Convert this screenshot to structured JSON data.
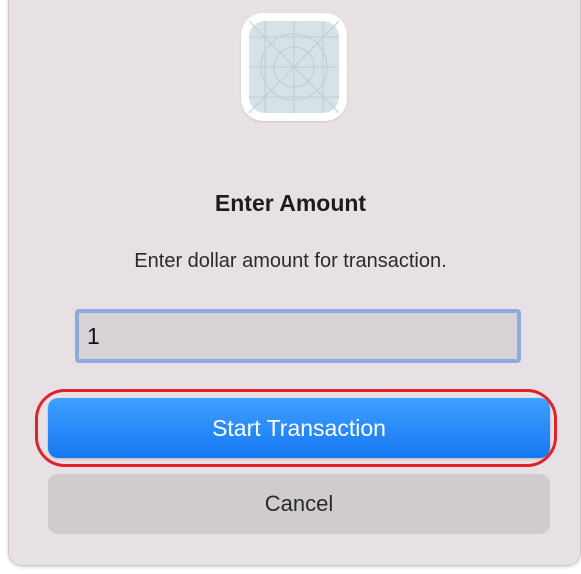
{
  "dialog": {
    "icon": "app-icon-placeholder",
    "title": "Enter Amount",
    "message": "Enter dollar amount for transaction.",
    "amount_input": {
      "value": "1",
      "placeholder": ""
    },
    "primary_button_label": "Start Transaction",
    "cancel_button_label": "Cancel"
  },
  "colors": {
    "primary": "#1677f2",
    "highlight": "#e0232b",
    "dialog_bg": "#e7e1e5"
  }
}
